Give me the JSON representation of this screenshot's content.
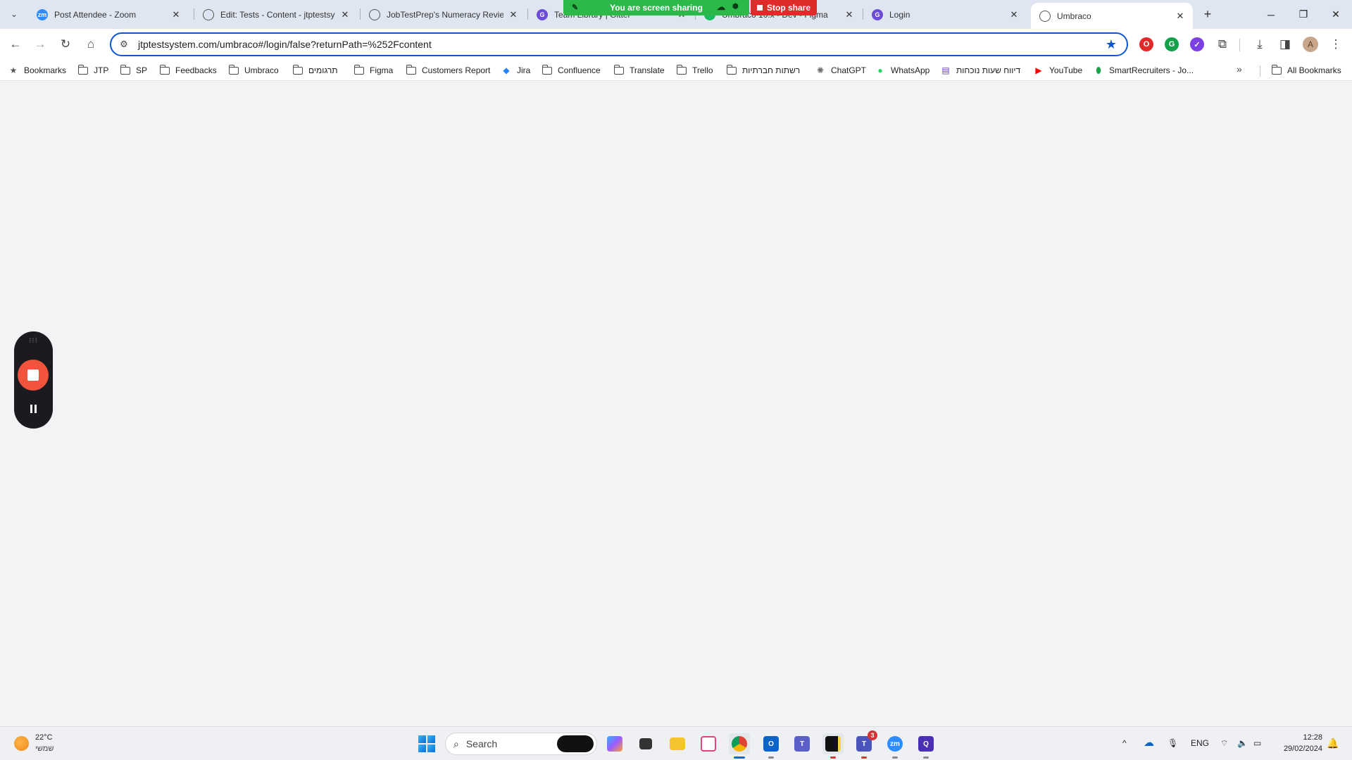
{
  "browser": {
    "tabs": [
      {
        "title": "Post Attendee - Zoom",
        "favicon": "zoom-icon",
        "active": false
      },
      {
        "title": "Edit: Tests - Content - jtptestsys",
        "favicon": "globe-icon",
        "active": false
      },
      {
        "title": "JobTestPrep's Numeracy Review",
        "favicon": "globe-icon",
        "active": false
      },
      {
        "title": "Team Library | Gitter",
        "favicon": "grammarly-icon",
        "active": false
      },
      {
        "title": "Umbraco 10.x - Dev - Figma",
        "favicon": "figma-icon",
        "active": false
      },
      {
        "title": "Login",
        "favicon": "grammarly-icon",
        "active": false
      },
      {
        "title": "Umbraco",
        "favicon": "globe-icon",
        "active": true
      }
    ],
    "screen_share": {
      "status_text": "You are screen sharing",
      "stop_label": "Stop share",
      "status_color": "#2db84a",
      "stop_color": "#e02b2b"
    },
    "address_bar": {
      "url": "jtptestsystem.com/umbraco#/login/false?returnPath=%252Fcontent"
    },
    "bookmarks": [
      {
        "label": "Bookmarks",
        "icon": "star-icon"
      },
      {
        "label": "JTP",
        "icon": "folder-icon"
      },
      {
        "label": "SP",
        "icon": "folder-icon"
      },
      {
        "label": "Feedbacks",
        "icon": "folder-icon"
      },
      {
        "label": "Umbraco",
        "icon": "folder-icon"
      },
      {
        "label": "תרגומים",
        "icon": "folder-icon"
      },
      {
        "label": "Figma",
        "icon": "folder-icon"
      },
      {
        "label": "Customers Report",
        "icon": "folder-icon"
      },
      {
        "label": "Jira",
        "icon": "jira-icon"
      },
      {
        "label": "Confluence",
        "icon": "folder-icon"
      },
      {
        "label": "Translate",
        "icon": "folder-icon"
      },
      {
        "label": "Trello",
        "icon": "folder-icon"
      },
      {
        "label": "רשתות חברתיות",
        "icon": "folder-icon"
      },
      {
        "label": "ChatGPT",
        "icon": "chatgpt-icon"
      },
      {
        "label": "WhatsApp",
        "icon": "whatsapp-icon"
      },
      {
        "label": "דיווח שעות נוכחות",
        "icon": "form-icon"
      },
      {
        "label": "YouTube",
        "icon": "youtube-icon"
      },
      {
        "label": "SmartRecruiters - Jo...",
        "icon": "smartrecruiters-icon"
      }
    ],
    "all_bookmarks_label": "All Bookmarks"
  },
  "taskbar": {
    "weather": {
      "temp": "22°C",
      "desc": "שמשי"
    },
    "search_label": "Search",
    "tray": {
      "language": "ENG"
    },
    "clock": {
      "time": "12:28",
      "date": "29/02/2024"
    },
    "notification_count": "3"
  },
  "colors": {
    "accent": "#0b57d0",
    "tabstrip": "#dfe6f1",
    "content_bg": "#f2f3f4",
    "recorder_stop": "#f0543c"
  }
}
